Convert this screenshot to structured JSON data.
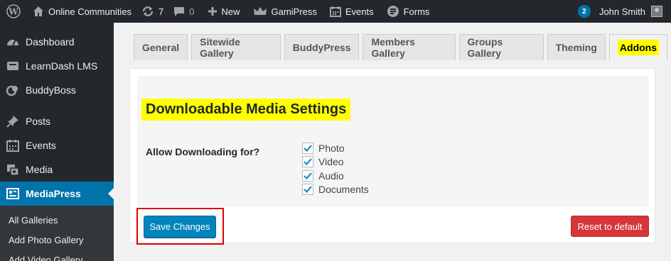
{
  "adminbar": {
    "site_name": "Online Communities",
    "updates_count": "7",
    "comments_count": "0",
    "new_label": "New",
    "gamipress_label": "GamiPress",
    "events_label": "Events",
    "forms_label": "Forms",
    "notifications_count": "2",
    "user_name": "John Smith"
  },
  "sidebar": {
    "items": [
      {
        "label": "Dashboard",
        "icon": "dashboard-icon"
      },
      {
        "label": "LearnDash LMS",
        "icon": "learndash-icon"
      },
      {
        "label": "BuddyBoss",
        "icon": "buddyboss-icon"
      },
      {
        "label": "Posts",
        "icon": "pin-icon"
      },
      {
        "label": "Events",
        "icon": "calendar-icon"
      },
      {
        "label": "Media",
        "icon": "media-icon"
      },
      {
        "label": "MediaPress",
        "icon": "gallery-icon"
      }
    ],
    "submenu": [
      "All Galleries",
      "Add Photo Gallery",
      "Add Video Gallery"
    ]
  },
  "tabs": [
    "General",
    "Sitewide Gallery",
    "BuddyPress",
    "Members Gallery",
    "Groups Gallery",
    "Theming",
    "Addons"
  ],
  "settings": {
    "section_title": "Downloadable Media Settings",
    "field_label": "Allow Downloading for?",
    "options": [
      {
        "label": "Photo",
        "checked": true
      },
      {
        "label": "Video",
        "checked": true
      },
      {
        "label": "Audio",
        "checked": true
      },
      {
        "label": "Documents",
        "checked": true
      }
    ]
  },
  "buttons": {
    "save_label": "Save Changes",
    "reset_label": "Reset to default"
  },
  "colors": {
    "adminbar": "#23282d",
    "accent": "#0073aa",
    "highlight": "#ffff00",
    "reset": "#d63638",
    "annotation_box": "#e00000"
  }
}
